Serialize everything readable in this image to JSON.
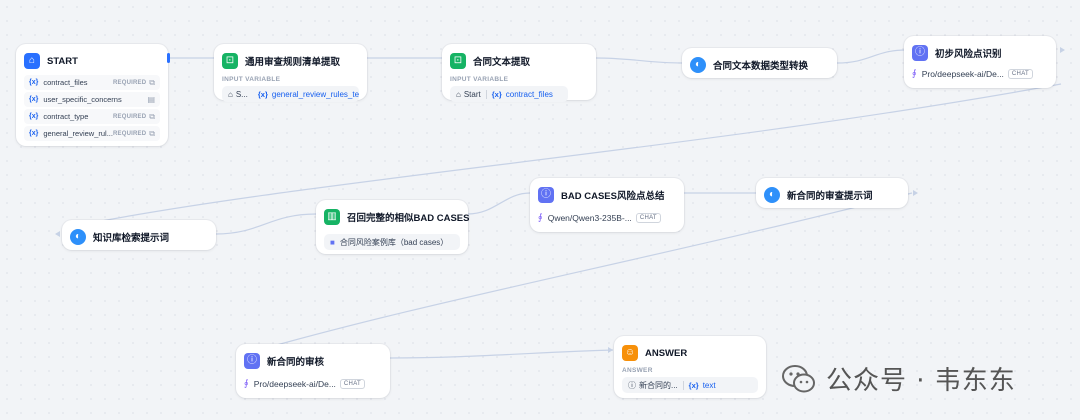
{
  "nodes": {
    "start": {
      "title": "START",
      "variables": [
        {
          "name": "contract_files",
          "required": "REQUIRED",
          "type_icon": "file-icon"
        },
        {
          "name": "user_specific_concerns",
          "required": "",
          "type_icon": "text-icon"
        },
        {
          "name": "contract_type",
          "required": "REQUIRED",
          "type_icon": "file-icon"
        },
        {
          "name": "general_review_rul...",
          "required": "REQUIRED",
          "type_icon": "file-icon"
        }
      ]
    },
    "rules_extract": {
      "title": "通用审查规则清单提取",
      "section": "INPUT VARIABLE",
      "src": "S...",
      "var": "general_review_rules_te..."
    },
    "contract_text": {
      "title": "合同文本提取",
      "section": "INPUT VARIABLE",
      "src": "Start",
      "var": "contract_files"
    },
    "type_convert": {
      "title": "合同文本数据类型转换"
    },
    "initial_risk": {
      "title": "初步风险点识别",
      "model": "Pro/deepseek-ai/De...",
      "badge": "CHAT"
    },
    "kb_prompt": {
      "title": "知识库检索提示词"
    },
    "recall": {
      "title": "召回完整的相似BAD CASES",
      "kb": "合同风险案例库（bad cases）"
    },
    "badcase_summary": {
      "title": "BAD CASES风险点总结",
      "model": "Qwen/Qwen3-235B-...",
      "badge": "CHAT"
    },
    "new_prompt": {
      "title": "新合同的审查提示词"
    },
    "new_review": {
      "title": "新合同的审核",
      "model": "Pro/deepseek-ai/De...",
      "badge": "CHAT"
    },
    "answer": {
      "title": "ANSWER",
      "section": "ANSWER",
      "src": "新合同的...",
      "var": "text"
    }
  },
  "watermark": {
    "text": "公众号 · 韦东东",
    "icon": "wechat-icon"
  },
  "colors": {
    "accent": "#2970ff",
    "llm": "#6172f3",
    "tool": "#16b364",
    "answer": "#f79009",
    "edge": "#c7d2e6"
  }
}
